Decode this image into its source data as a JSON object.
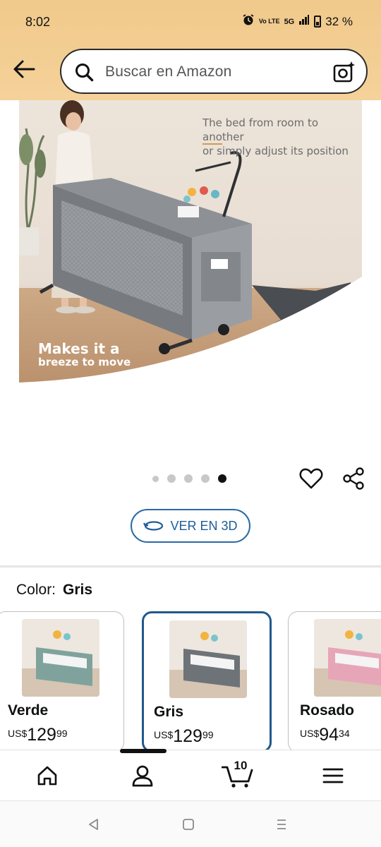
{
  "status": {
    "time": "8:02",
    "battery": "32 %",
    "network": "5G",
    "volte": "Vo LTE"
  },
  "search": {
    "placeholder": "Buscar en Amazon"
  },
  "product_image": {
    "tagline_line1_pre": "The bed from room to ",
    "tagline_line1_under": "ano",
    "tagline_line1_post": "ther",
    "tagline_line2": "or simply adjust its position",
    "slogan_line1": "Makes it a",
    "slogan_line2": "breeze to move"
  },
  "carousel": {
    "total": 5,
    "active_index": 4
  },
  "view3d": {
    "label": "VER EN 3D"
  },
  "color_selector": {
    "label": "Color:",
    "selected": "Gris",
    "options": [
      {
        "name": "Verde",
        "currency": "US$",
        "whole": "129",
        "fraction": "99",
        "tint": "#7fa39c"
      },
      {
        "name": "Gris",
        "currency": "US$",
        "whole": "129",
        "fraction": "99",
        "tint": "#6e7378"
      },
      {
        "name": "Rosado",
        "currency": "US$",
        "whole": "94",
        "fraction": "34",
        "tint": "#e7a6b8"
      }
    ]
  },
  "bottom_nav": {
    "cart_count": "10",
    "active": "account"
  },
  "colors": {
    "header_bg": "#f3cd93",
    "accent_blue": "#20598c",
    "text": "#0f1111"
  }
}
